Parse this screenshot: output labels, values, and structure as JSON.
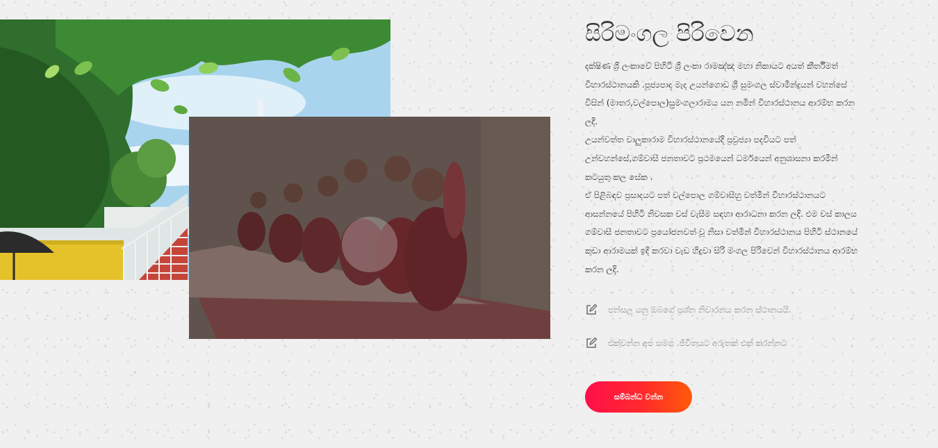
{
  "about": {
    "title": "සිරිමංගල පිරිවෙන",
    "paragraphs": [
      "දක්ෂිණ ශ්‍රී ලංකාවේ පිහිටි ශ්‍රී ලංකා රාමඤ්ඤ මහා නිකායට අයත් කීර්තිමත් විහාරස්ථානයකි .පූජ්‍යපාද මැද උයන්ගොඩ ශ්‍රී සුමංගල ස්වාමීන්ද්‍රයන් වහන්සේ විසින් (මාතර,වල්පොල)සුමංගලාරාමය යන නමින් විහාරස්ථානය ආරම්භ කරන ලදි.",
      "උයන්වත්ත වාලුකාරාම විහාරස්ථානයේදී ප්‍රව්‍රජ්‍යා පදවියට පත් උන්වහන්සේ,ගම්වාසී ජනතාවට ප්‍රථමයෙන් ධර්මයෙන් අනුශාසනා කරමින් කටයුතු කල සේක .",
      "ඒ පිළිබඳව ප්‍රසාදයට පත් වල්පොල ගම්වාසීහු වත්මින් විහාරස්ථානයට ආසන්නයේ පිහිටි නිවසක වස් වැසීම සඳහා ආරාධනා කරන ලදි. එම වස් කාලය ගම්වාසී ජනතාවට ප්‍රයෝජනවත් වූ නිසා වත්මින් විහාරස්ථානය පිහිටි ස්ථානයේ කුඩා ආරාමයක් ඉදි කරවා වැඩ හිදුවා සිරි මංගල පිරිවෙන් විහාරස්ථානය ආරම්භ කරන ලදි."
    ]
  },
  "features": [
    {
      "icon": "edit-icon",
      "text": "පන්සල යනු ඔබගේ ප්‍රශ්න නිවාරනය කරන ස්ථානයයි."
    },
    {
      "icon": "edit-icon",
      "text": "එක්වන්න අප සමග .ජීවිතයට අරුතක් එක් කරන්නට"
    }
  ],
  "cta": {
    "label": "සම්බන්ධ වන්න"
  },
  "video": {
    "play_icon": "play-icon"
  },
  "colors": {
    "accent_start": "#ff0f4a",
    "accent_end": "#ff5a0a",
    "title": "#3a3a3a",
    "body_text": "#2e2e2e",
    "muted_text": "#8a8a8a"
  }
}
